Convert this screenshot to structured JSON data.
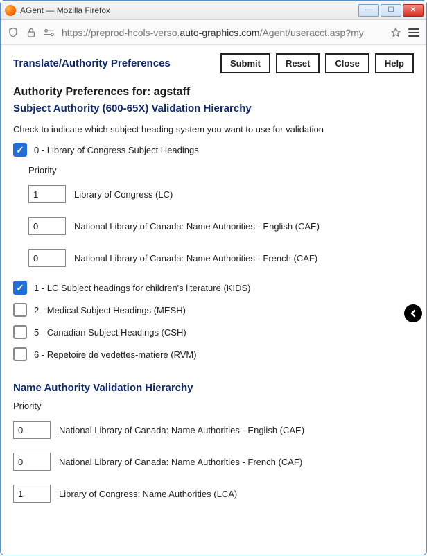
{
  "window": {
    "title": "AGent — Mozilla Firefox"
  },
  "url": {
    "prefix": "https://preprod-hcols-verso.",
    "domain": "auto-graphics.com",
    "suffix": "/Agent/useracct.asp?my"
  },
  "header": {
    "page_title": "Translate/Authority Preferences",
    "buttons": {
      "submit": "Submit",
      "reset": "Reset",
      "close": "Close",
      "help": "Help"
    }
  },
  "prefs_for": "Authority Preferences for: agstaff",
  "subject_section": {
    "title": "Subject Authority (600-65X) Validation Hierarchy",
    "instruction": "Check to indicate which subject heading system you want to use for validation",
    "priority_label": "Priority",
    "options": [
      {
        "checked": true,
        "label": "0 - Library of Congress Subject Headings",
        "priorities": [
          {
            "value": "1",
            "label": "Library of Congress (LC)"
          },
          {
            "value": "0",
            "label": "National Library of Canada: Name Authorities - English (CAE)"
          },
          {
            "value": "0",
            "label": "National Library of Canada: Name Authorities - French (CAF)"
          }
        ]
      },
      {
        "checked": true,
        "label": "1 - LC Subject headings for children's literature (KIDS)"
      },
      {
        "checked": false,
        "label": "2 - Medical Subject Headings (MESH)"
      },
      {
        "checked": false,
        "label": "5 - Canadian Subject Headings (CSH)"
      },
      {
        "checked": false,
        "label": "6 - Repetoire de vedettes-matiere (RVM)"
      }
    ]
  },
  "name_section": {
    "title": "Name Authority Validation Hierarchy",
    "priority_label": "Priority",
    "priorities": [
      {
        "value": "0",
        "label": "National Library of Canada: Name Authorities - English (CAE)"
      },
      {
        "value": "0",
        "label": "National Library of Canada: Name Authorities - French (CAF)"
      },
      {
        "value": "1",
        "label": "Library of Congress: Name Authorities (LCA)"
      }
    ]
  }
}
